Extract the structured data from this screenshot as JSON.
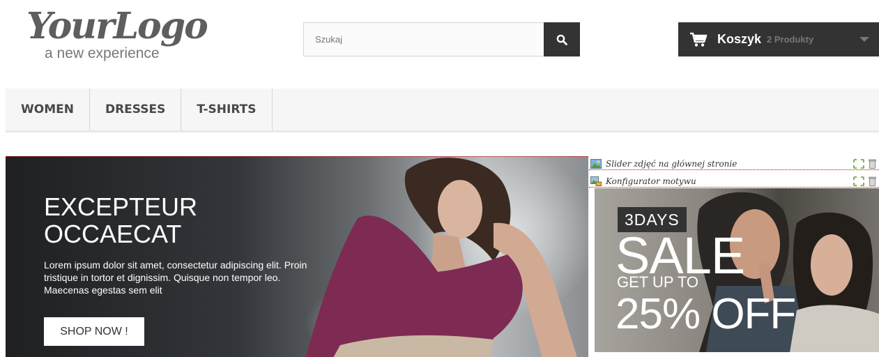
{
  "header": {
    "logo": {
      "main": "YourLogo",
      "sub": "a new experience"
    },
    "search": {
      "placeholder": "Szukaj",
      "button_icon": "search-icon"
    },
    "cart": {
      "icon": "cart-icon",
      "title": "Koszyk",
      "count": "2 Produkty",
      "caret_icon": "caret-down-icon"
    }
  },
  "menu": {
    "items": [
      {
        "label": "WOMEN"
      },
      {
        "label": "DRESSES"
      },
      {
        "label": "T-SHIRTS"
      }
    ]
  },
  "hero": {
    "title_line1": "EXCEPTEUR",
    "title_line2": "OCCAECAT",
    "text": "Lorem ipsum dolor sit amet, consectetur adipiscing elit. Proin tristique in tortor et dignissim. Quisque non tempor leo. Maecenas egestas sem elit",
    "button": "SHOP NOW !"
  },
  "modules": [
    {
      "label": "Slider zdjęć na głównej stronie",
      "icon": "image-module-icon"
    },
    {
      "label": "Konfigurator motywu",
      "icon": "theme-module-icon"
    }
  ],
  "side_banner": {
    "days": "3DAYS",
    "sale": "SALE",
    "get_up_to": "GET UP TO",
    "off": "25% OFF"
  },
  "colors": {
    "dark": "#333333",
    "menu_bg": "#f6f6f6",
    "border": "#d6d4d4",
    "module_outline": "#cc0000"
  }
}
